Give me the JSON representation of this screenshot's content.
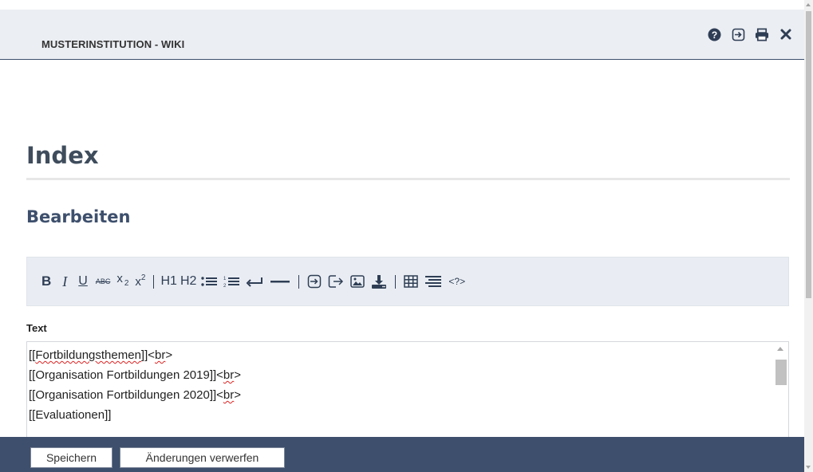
{
  "header": {
    "title": "MUSTERINSTITUTION - WIKI",
    "icons": [
      "question-circle-icon",
      "sign-in-icon",
      "print-icon",
      "close-icon"
    ]
  },
  "page": {
    "title": "Index",
    "section": "Bearbeiten"
  },
  "toolbar": {
    "bold": "B",
    "italic": "I",
    "underline": "U",
    "strike": "ABC",
    "subscript": "x",
    "subscript_mark": "2",
    "superscript": "x",
    "superscript_mark": "2",
    "h1": "H1",
    "h2": "H2",
    "source": "<?>",
    "icons": [
      "unordered-list-icon",
      "ordered-list-icon",
      "line-break-icon",
      "horizontal-rule-icon",
      "internal-link-icon",
      "external-link-icon",
      "image-icon",
      "download-icon",
      "table-icon",
      "align-icon"
    ]
  },
  "editor": {
    "label": "Text",
    "lines": [
      {
        "open": "[[",
        "spelled": "Fortbildungsthemen",
        "close": "]]<",
        "tag": "br",
        "end": ">"
      },
      {
        "open": "[[Organisation Fortbildungen 2019]]<",
        "spelled": "",
        "close": "",
        "tag": "br",
        "end": ">"
      },
      {
        "open": "[[Organisation Fortbildungen 2020]]<",
        "spelled": "",
        "close": "",
        "tag": "br",
        "end": ">"
      },
      {
        "open": "[[Evaluationen]]",
        "spelled": "",
        "close": "",
        "tag": "",
        "end": ""
      }
    ]
  },
  "footer": {
    "save_label": "Speichern",
    "discard_label": "Änderungen verwerfen"
  },
  "colors": {
    "header_bg": "#ebeef3",
    "navy": "#3d4f6c",
    "toolbar_bg": "#e9edf3"
  }
}
